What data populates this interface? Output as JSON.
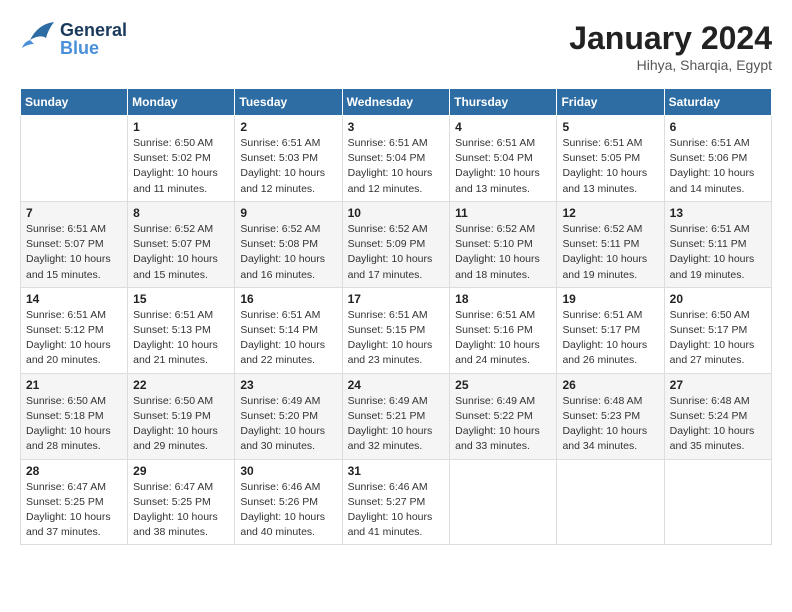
{
  "header": {
    "logo_general": "General",
    "logo_blue": "Blue",
    "month_title": "January 2024",
    "location": "Hihya, Sharqia, Egypt"
  },
  "calendar": {
    "days_of_week": [
      "Sunday",
      "Monday",
      "Tuesday",
      "Wednesday",
      "Thursday",
      "Friday",
      "Saturday"
    ],
    "weeks": [
      [
        {
          "day": "",
          "info": ""
        },
        {
          "day": "1",
          "info": "Sunrise: 6:50 AM\nSunset: 5:02 PM\nDaylight: 10 hours\nand 11 minutes."
        },
        {
          "day": "2",
          "info": "Sunrise: 6:51 AM\nSunset: 5:03 PM\nDaylight: 10 hours\nand 12 minutes."
        },
        {
          "day": "3",
          "info": "Sunrise: 6:51 AM\nSunset: 5:04 PM\nDaylight: 10 hours\nand 12 minutes."
        },
        {
          "day": "4",
          "info": "Sunrise: 6:51 AM\nSunset: 5:04 PM\nDaylight: 10 hours\nand 13 minutes."
        },
        {
          "day": "5",
          "info": "Sunrise: 6:51 AM\nSunset: 5:05 PM\nDaylight: 10 hours\nand 13 minutes."
        },
        {
          "day": "6",
          "info": "Sunrise: 6:51 AM\nSunset: 5:06 PM\nDaylight: 10 hours\nand 14 minutes."
        }
      ],
      [
        {
          "day": "7",
          "info": "Sunrise: 6:51 AM\nSunset: 5:07 PM\nDaylight: 10 hours\nand 15 minutes."
        },
        {
          "day": "8",
          "info": "Sunrise: 6:52 AM\nSunset: 5:07 PM\nDaylight: 10 hours\nand 15 minutes."
        },
        {
          "day": "9",
          "info": "Sunrise: 6:52 AM\nSunset: 5:08 PM\nDaylight: 10 hours\nand 16 minutes."
        },
        {
          "day": "10",
          "info": "Sunrise: 6:52 AM\nSunset: 5:09 PM\nDaylight: 10 hours\nand 17 minutes."
        },
        {
          "day": "11",
          "info": "Sunrise: 6:52 AM\nSunset: 5:10 PM\nDaylight: 10 hours\nand 18 minutes."
        },
        {
          "day": "12",
          "info": "Sunrise: 6:52 AM\nSunset: 5:11 PM\nDaylight: 10 hours\nand 19 minutes."
        },
        {
          "day": "13",
          "info": "Sunrise: 6:51 AM\nSunset: 5:11 PM\nDaylight: 10 hours\nand 19 minutes."
        }
      ],
      [
        {
          "day": "14",
          "info": "Sunrise: 6:51 AM\nSunset: 5:12 PM\nDaylight: 10 hours\nand 20 minutes."
        },
        {
          "day": "15",
          "info": "Sunrise: 6:51 AM\nSunset: 5:13 PM\nDaylight: 10 hours\nand 21 minutes."
        },
        {
          "day": "16",
          "info": "Sunrise: 6:51 AM\nSunset: 5:14 PM\nDaylight: 10 hours\nand 22 minutes."
        },
        {
          "day": "17",
          "info": "Sunrise: 6:51 AM\nSunset: 5:15 PM\nDaylight: 10 hours\nand 23 minutes."
        },
        {
          "day": "18",
          "info": "Sunrise: 6:51 AM\nSunset: 5:16 PM\nDaylight: 10 hours\nand 24 minutes."
        },
        {
          "day": "19",
          "info": "Sunrise: 6:51 AM\nSunset: 5:17 PM\nDaylight: 10 hours\nand 26 minutes."
        },
        {
          "day": "20",
          "info": "Sunrise: 6:50 AM\nSunset: 5:17 PM\nDaylight: 10 hours\nand 27 minutes."
        }
      ],
      [
        {
          "day": "21",
          "info": "Sunrise: 6:50 AM\nSunset: 5:18 PM\nDaylight: 10 hours\nand 28 minutes."
        },
        {
          "day": "22",
          "info": "Sunrise: 6:50 AM\nSunset: 5:19 PM\nDaylight: 10 hours\nand 29 minutes."
        },
        {
          "day": "23",
          "info": "Sunrise: 6:49 AM\nSunset: 5:20 PM\nDaylight: 10 hours\nand 30 minutes."
        },
        {
          "day": "24",
          "info": "Sunrise: 6:49 AM\nSunset: 5:21 PM\nDaylight: 10 hours\nand 32 minutes."
        },
        {
          "day": "25",
          "info": "Sunrise: 6:49 AM\nSunset: 5:22 PM\nDaylight: 10 hours\nand 33 minutes."
        },
        {
          "day": "26",
          "info": "Sunrise: 6:48 AM\nSunset: 5:23 PM\nDaylight: 10 hours\nand 34 minutes."
        },
        {
          "day": "27",
          "info": "Sunrise: 6:48 AM\nSunset: 5:24 PM\nDaylight: 10 hours\nand 35 minutes."
        }
      ],
      [
        {
          "day": "28",
          "info": "Sunrise: 6:47 AM\nSunset: 5:25 PM\nDaylight: 10 hours\nand 37 minutes."
        },
        {
          "day": "29",
          "info": "Sunrise: 6:47 AM\nSunset: 5:25 PM\nDaylight: 10 hours\nand 38 minutes."
        },
        {
          "day": "30",
          "info": "Sunrise: 6:46 AM\nSunset: 5:26 PM\nDaylight: 10 hours\nand 40 minutes."
        },
        {
          "day": "31",
          "info": "Sunrise: 6:46 AM\nSunset: 5:27 PM\nDaylight: 10 hours\nand 41 minutes."
        },
        {
          "day": "",
          "info": ""
        },
        {
          "day": "",
          "info": ""
        },
        {
          "day": "",
          "info": ""
        }
      ]
    ]
  }
}
